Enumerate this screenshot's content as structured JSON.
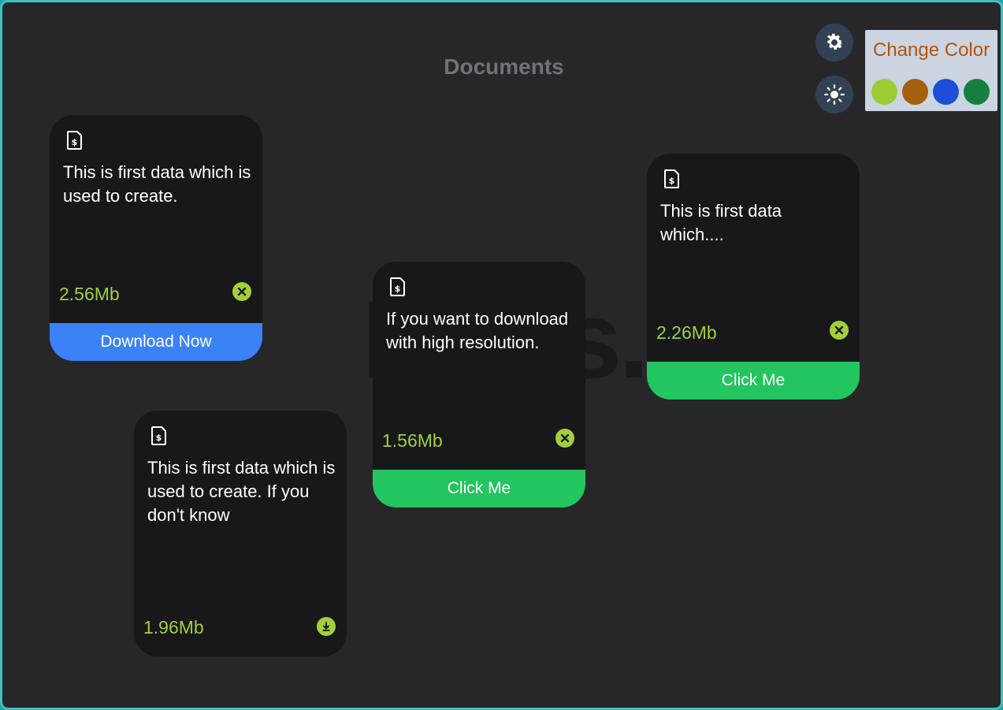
{
  "page": {
    "title": "Documents",
    "background_text": "Docs."
  },
  "toolbar": {
    "settings_icon": "gear-icon",
    "theme_icon": "sun-icon"
  },
  "color_picker": {
    "label": "Change Color",
    "swatches": [
      {
        "name": "lime",
        "color": "#9acd32"
      },
      {
        "name": "brown",
        "color": "#a5600e"
      },
      {
        "name": "blue",
        "color": "#1d4ed8"
      },
      {
        "name": "green",
        "color": "#15803d"
      }
    ]
  },
  "colors": {
    "accent_size": "#a3cf3a",
    "card_bg": "#18181b",
    "page_bg": "#27272a",
    "download_button": "#3b82f6",
    "click_button": "#22c55e"
  },
  "cards": [
    {
      "description": "This is first data which is used to create.",
      "size": "2.56Mb",
      "action_icon": "close-circle-icon",
      "button_label": "Download Now",
      "button_color": "#3b82f6"
    },
    {
      "description": "This is first data which is used to create. If you don't know",
      "size": "1.96Mb",
      "action_icon": "download-circle-icon",
      "button_label": null
    },
    {
      "description": "If you want to download with high resolution.",
      "size": "1.56Mb",
      "action_icon": "close-circle-icon",
      "button_label": "Click Me",
      "button_color": "#22c55e"
    },
    {
      "description": "This is first data which....",
      "size": "2.26Mb",
      "action_icon": "close-circle-icon",
      "button_label": "Click Me",
      "button_color": "#22c55e"
    }
  ]
}
